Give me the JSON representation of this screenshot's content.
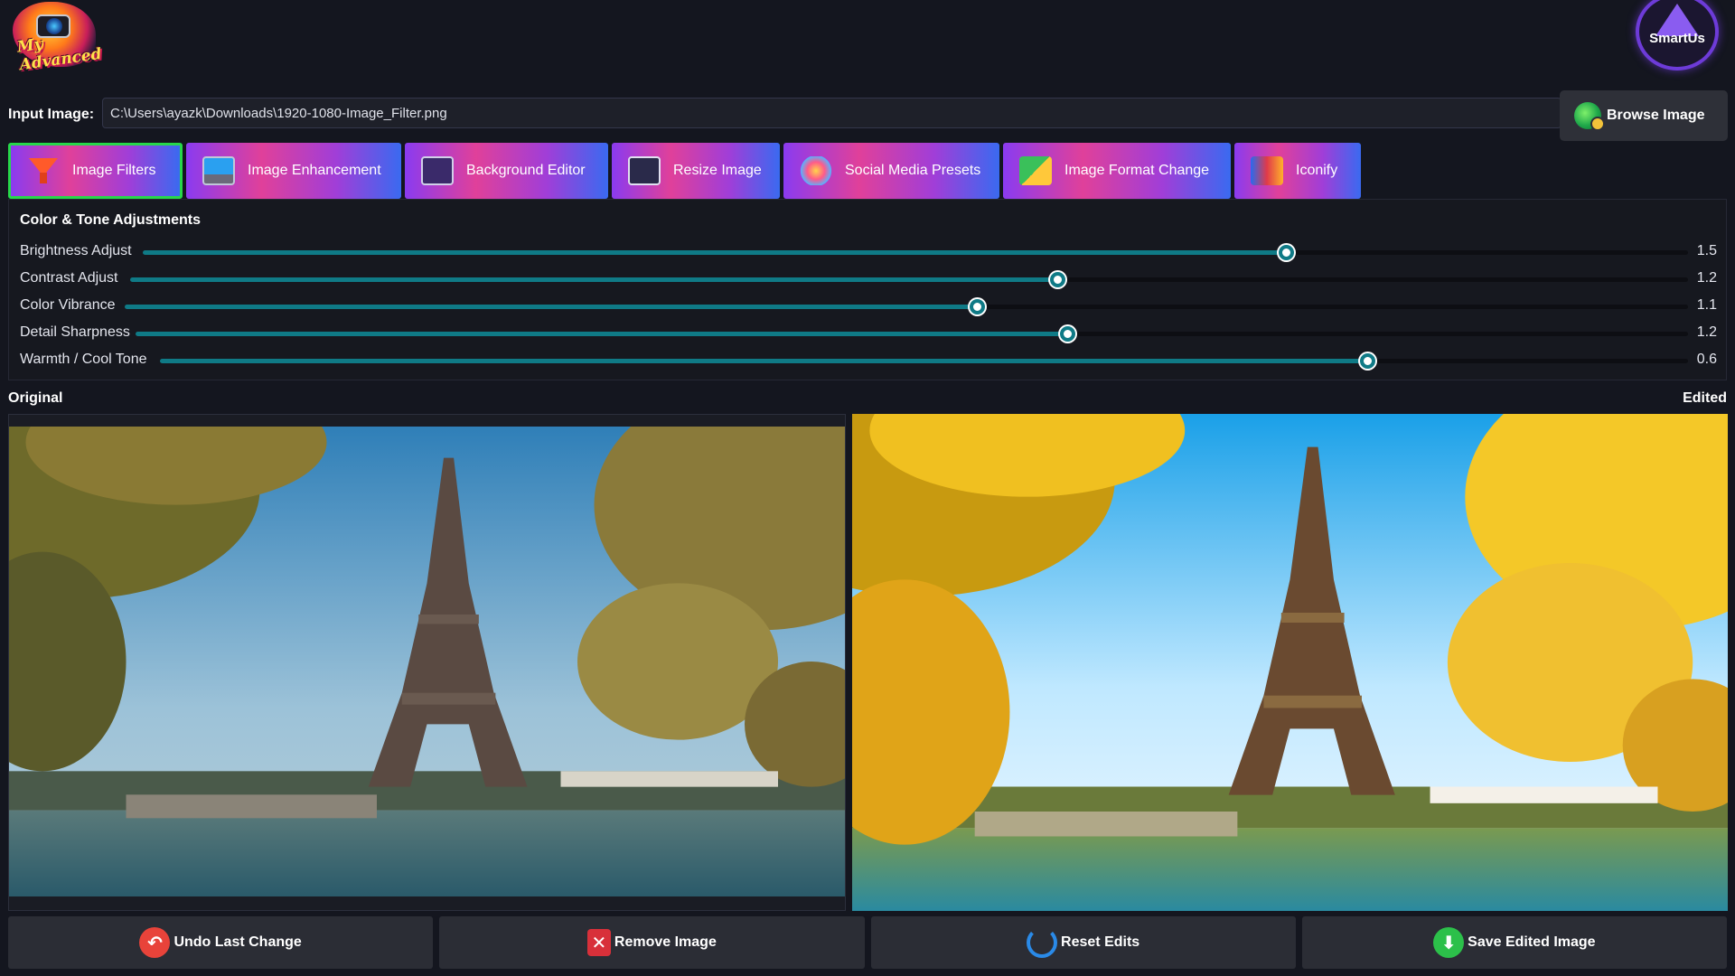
{
  "header": {
    "left_logo_text": "My Advanced",
    "right_logo_text": "SmartUs"
  },
  "input": {
    "label": "Input Image:",
    "path": "C:\\Users\\ayazk\\Downloads\\1920-1080-Image_Filter.png",
    "browse_label": "Browse Image"
  },
  "tabs": [
    {
      "label": "Image Filters",
      "icon": "filter-funnel-icon",
      "active": true
    },
    {
      "label": "Image Enhancement",
      "icon": "monitor-icon",
      "active": false
    },
    {
      "label": "Background Editor",
      "icon": "background-editor-icon",
      "active": false
    },
    {
      "label": "Resize Image",
      "icon": "resize-icon",
      "active": false
    },
    {
      "label": "Social Media Presets",
      "icon": "social-media-icon",
      "active": false
    },
    {
      "label": "Image Format Change",
      "icon": "format-change-icon",
      "active": false
    },
    {
      "label": "Iconify",
      "icon": "iconify-icon",
      "active": false
    }
  ],
  "adjustments": {
    "title": "Color & Tone Adjustments",
    "sliders": [
      {
        "label": "Brightness Adjust",
        "value": "1.5",
        "fraction": 0.74
      },
      {
        "label": "Contrast Adjust",
        "value": "1.2",
        "fraction": 0.595
      },
      {
        "label": "Color Vibrance",
        "value": "1.1",
        "fraction": 0.545
      },
      {
        "label": "Detail Sharpness",
        "value": "1.2",
        "fraction": 0.6
      },
      {
        "label": "Warmth / Cool Tone",
        "value": "0.6",
        "fraction": 0.79
      }
    ]
  },
  "preview": {
    "original_label": "Original",
    "edited_label": "Edited"
  },
  "actions": {
    "undo": "Undo Last Change",
    "remove": "Remove Image",
    "reset": "Reset Edits",
    "save": "Save Edited Image"
  },
  "colors": {
    "background": "#14161f",
    "slider_fill": "#0f7a86",
    "active_tab_border": "#27d84a"
  }
}
